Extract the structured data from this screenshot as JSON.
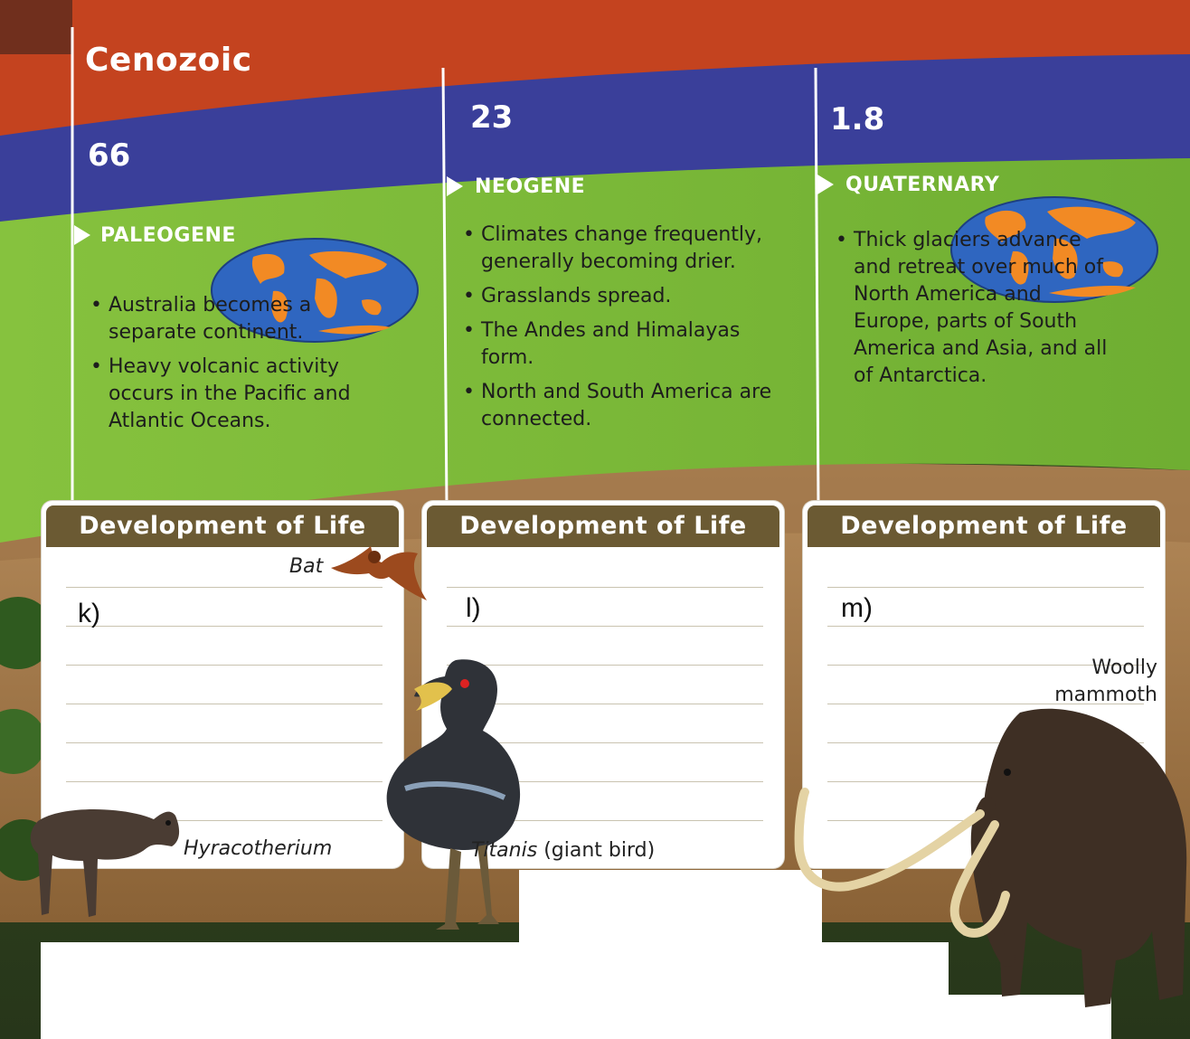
{
  "era": {
    "title": "Cenozoic"
  },
  "periods": [
    {
      "start_mya": "66",
      "name": "PALEOGENE",
      "facts": [
        "Australia becomes a separate continent.",
        "Heavy volcanic activity occurs in the Pacific and Atlantic Oceans."
      ]
    },
    {
      "start_mya": "23",
      "name": "NEOGENE",
      "facts": [
        "Climates change frequently, generally becoming drier.",
        "Grasslands spread.",
        "The Andes and Himalayas form.",
        "North and South America are connected."
      ]
    },
    {
      "start_mya": "1.8",
      "name": "QUATERNARY",
      "facts": [
        "Thick glaciers advance and retreat over much of North America and Europe, parts of South America and Asia, and all of Antarctica."
      ]
    }
  ],
  "cards": [
    {
      "heading": "Development of Life",
      "answer_label": "k)"
    },
    {
      "heading": "Development of Life",
      "answer_label": "l)"
    },
    {
      "heading": "Development of Life",
      "answer_label": "m)"
    }
  ],
  "captions": {
    "bat": "Bat",
    "hyracotherium": "Hyracotherium",
    "titanis_name": "Titanis",
    "titanis_note": "(giant bird)",
    "woolly": "Woolly",
    "mammoth": "mammoth"
  },
  "icons": [
    "globe-icon",
    "bat-icon",
    "hyracotherium-icon",
    "titanis-icon",
    "mammoth-icon"
  ],
  "colors": {
    "era_band": "#c4431f",
    "period_band": "#3a3f9a",
    "facts_panel": "#7cb83a",
    "card_header": "#6b5a33",
    "continents": "#f28a24",
    "ocean": "#2f66c0"
  }
}
